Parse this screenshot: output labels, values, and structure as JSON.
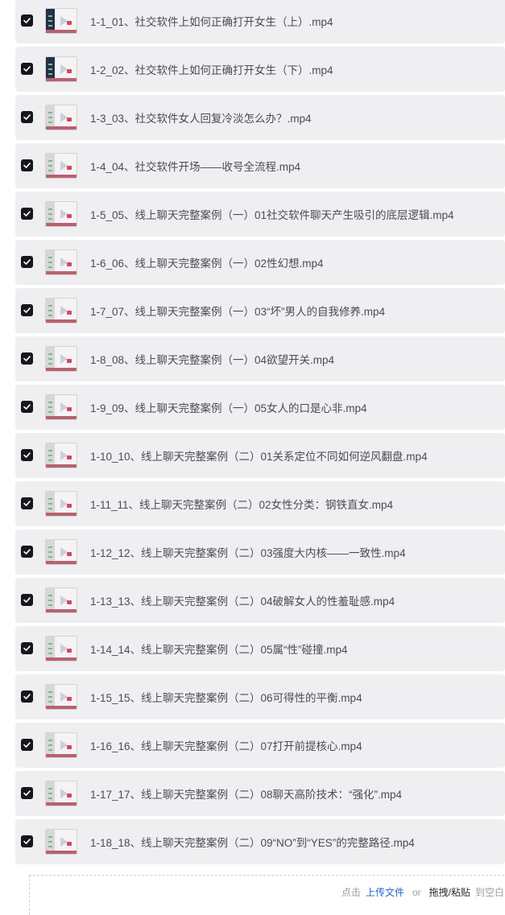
{
  "files": [
    {
      "name": "1-1_01、社交软件上如何正确打开女生（上）.mp4",
      "checked": true,
      "thumb": "dark"
    },
    {
      "name": "1-2_02、社交软件上如何正确打开女生（下）.mp4",
      "checked": true,
      "thumb": "dark"
    },
    {
      "name": "1-3_03、社交软件女人回复冷淡怎么办？.mp4",
      "checked": true,
      "thumb": "light"
    },
    {
      "name": "1-4_04、社交软件开场——收号全流程.mp4",
      "checked": true,
      "thumb": "light"
    },
    {
      "name": "1-5_05、线上聊天完整案例（一）01社交软件聊天产生吸引的底层逻辑.mp4",
      "checked": true,
      "thumb": "light"
    },
    {
      "name": "1-6_06、线上聊天完整案例（一）02性幻想.mp4",
      "checked": true,
      "thumb": "light"
    },
    {
      "name": "1-7_07、线上聊天完整案例（一）03“坏”男人的自我修养.mp4",
      "checked": true,
      "thumb": "light"
    },
    {
      "name": "1-8_08、线上聊天完整案例（一）04欲望开关.mp4",
      "checked": true,
      "thumb": "light"
    },
    {
      "name": "1-9_09、线上聊天完整案例（一）05女人的口是心非.mp4",
      "checked": true,
      "thumb": "light"
    },
    {
      "name": "1-10_10、线上聊天完整案例（二）01关系定位不同如何逆风翻盘.mp4",
      "checked": true,
      "thumb": "light"
    },
    {
      "name": "1-11_11、线上聊天完整案例（二）02女性分类：钢铁直女.mp4",
      "checked": true,
      "thumb": "light"
    },
    {
      "name": "1-12_12、线上聊天完整案例（二）03强度大内核——一致性.mp4",
      "checked": true,
      "thumb": "light"
    },
    {
      "name": "1-13_13、线上聊天完整案例（二）04破解女人的性羞耻感.mp4",
      "checked": true,
      "thumb": "light"
    },
    {
      "name": "1-14_14、线上聊天完整案例（二）05属“性”碰撞.mp4",
      "checked": true,
      "thumb": "light"
    },
    {
      "name": "1-15_15、线上聊天完整案例（二）06可得性的平衡.mp4",
      "checked": true,
      "thumb": "light"
    },
    {
      "name": "1-16_16、线上聊天完整案例（二）07打开前提核心.mp4",
      "checked": true,
      "thumb": "light"
    },
    {
      "name": "1-17_17、线上聊天完整案例（二）08聊天高阶技术：“强化”.mp4",
      "checked": true,
      "thumb": "light"
    },
    {
      "name": "1-18_18、线上聊天完整案例（二）09“NO”到“YES”的完整路径.mp4",
      "checked": true,
      "thumb": "light"
    }
  ],
  "upload": {
    "click_label": "点击",
    "upload_link": "上传文件",
    "or_label": "or",
    "drag_label": "拖拽/粘贴",
    "target_label": "到空白"
  },
  "colors": {
    "item_bg": "#efeff2",
    "checkbox": "#15171f",
    "link": "#1f68c9"
  }
}
